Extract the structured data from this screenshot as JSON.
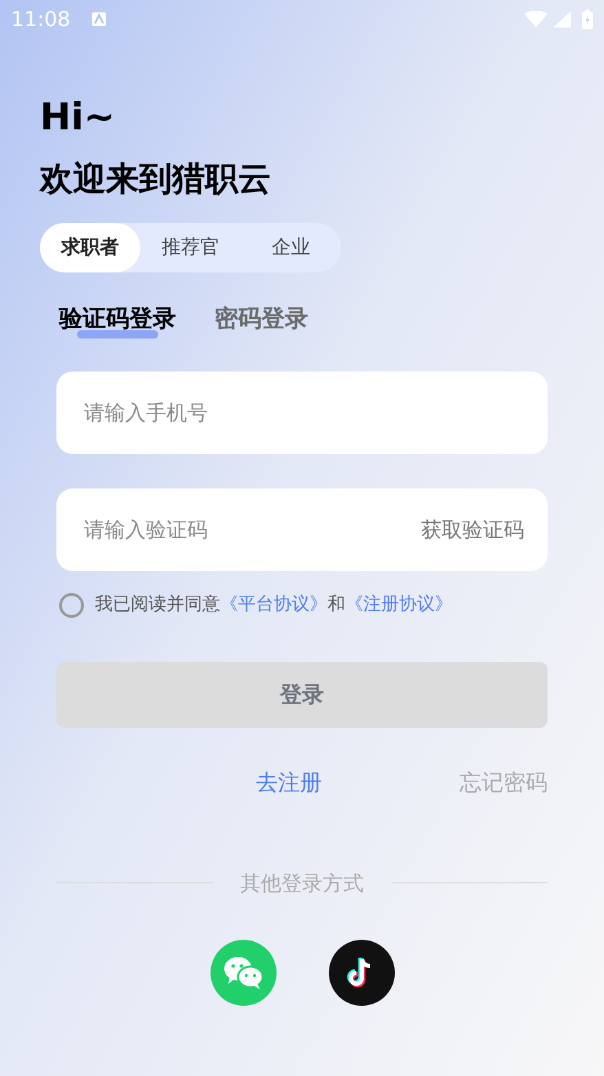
{
  "status_bar": {
    "time": "11:08"
  },
  "greeting": "Hi~",
  "welcome": "欢迎来到猎职云",
  "roles": [
    {
      "label": "求职者",
      "selected": true
    },
    {
      "label": "推荐官",
      "selected": false
    },
    {
      "label": "企业",
      "selected": false
    }
  ],
  "login_tabs": [
    {
      "label": "验证码登录",
      "selected": true
    },
    {
      "label": "密码登录",
      "selected": false
    }
  ],
  "phone_field": {
    "placeholder": "请输入手机号"
  },
  "code_field": {
    "placeholder": "请输入验证码",
    "get_code": "获取验证码"
  },
  "agreement": {
    "checked": false,
    "prefix": "我已阅读并同意",
    "link_1": "《平台协议》",
    "joiner": "和",
    "link_2": "《注册协议》"
  },
  "login_button": {
    "label": "登录",
    "disabled": true
  },
  "register_link": "去注册",
  "forgot_link": "忘记密码",
  "other_login": {
    "label": "其他登录方式"
  },
  "social": [
    {
      "kind": "wechat"
    },
    {
      "kind": "tiktok"
    }
  ]
}
